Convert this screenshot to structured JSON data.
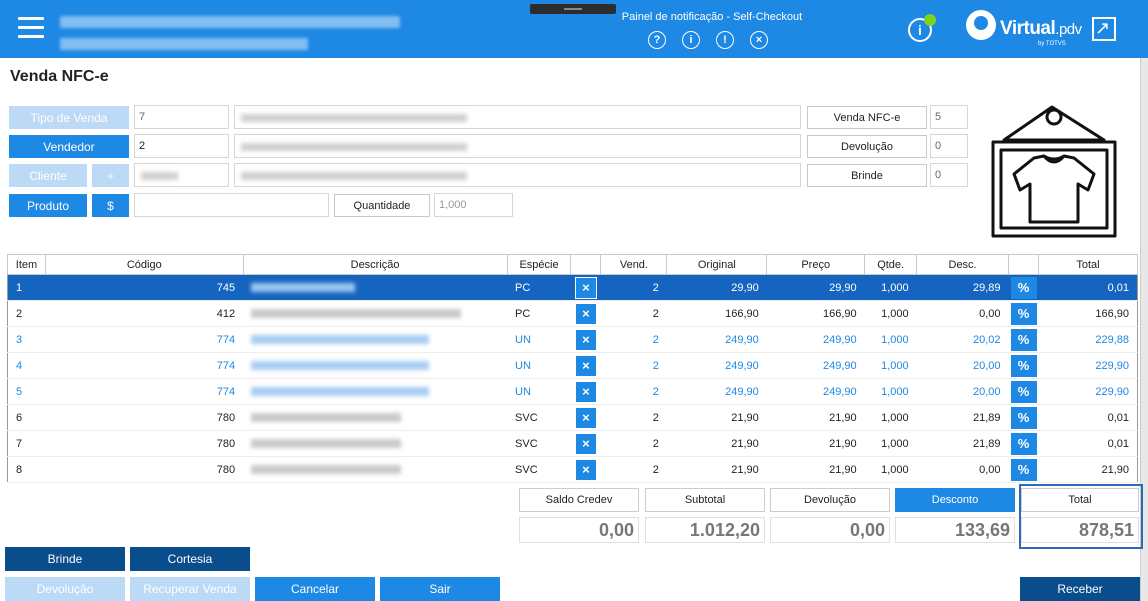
{
  "header": {
    "notification_title": "Painel de notificação - Self-Checkout",
    "notif_icons": [
      "?",
      "i",
      "!",
      "×"
    ],
    "info_icon": "i",
    "brand_name": "Virtual",
    "brand_suffix": ".pdv",
    "brand_byline": "by TOTVS",
    "accent_color": "#1e88e5"
  },
  "page_title": "Venda NFC-e",
  "form": {
    "tipo_venda_label": "Tipo de Venda",
    "tipo_venda_value": "7",
    "vendedor_label": "Vendedor",
    "vendedor_value": "2",
    "cliente_label": "Cliente",
    "cliente_add": "+",
    "produto_label": "Produto",
    "produto_dollar": "$",
    "quantidade_label": "Quantidade",
    "quantidade_placeholder": "1,000",
    "venda_nfce_label": "Venda NFC-e",
    "venda_nfce_value": "5",
    "devolucao_label": "Devolução",
    "devolucao_value": "0",
    "brinde_label": "Brinde",
    "brinde_value": "0"
  },
  "table": {
    "headers": [
      "Item",
      "Código",
      "Descrição",
      "Espécie",
      "",
      "Vend.",
      "Original",
      "Preço",
      "Qtde.",
      "Desc.",
      "",
      "Total"
    ],
    "rows": [
      {
        "item": "1",
        "codigo": "745",
        "especie": "PC",
        "vend": "2",
        "original": "29,90",
        "preco": "29,90",
        "qtde": "1,000",
        "desc": "29,89",
        "total": "0,01",
        "style": "sel"
      },
      {
        "item": "2",
        "codigo": "412",
        "especie": "PC",
        "vend": "2",
        "original": "166,90",
        "preco": "166,90",
        "qtde": "1,000",
        "desc": "0,00",
        "total": "166,90",
        "style": ""
      },
      {
        "item": "3",
        "codigo": "774",
        "especie": "UN",
        "vend": "2",
        "original": "249,90",
        "preco": "249,90",
        "qtde": "1,000",
        "desc": "20,02",
        "total": "229,88",
        "style": "blue"
      },
      {
        "item": "4",
        "codigo": "774",
        "especie": "UN",
        "vend": "2",
        "original": "249,90",
        "preco": "249,90",
        "qtde": "1,000",
        "desc": "20,00",
        "total": "229,90",
        "style": "blue"
      },
      {
        "item": "5",
        "codigo": "774",
        "especie": "UN",
        "vend": "2",
        "original": "249,90",
        "preco": "249,90",
        "qtde": "1,000",
        "desc": "20,00",
        "total": "229,90",
        "style": "blue"
      },
      {
        "item": "6",
        "codigo": "780",
        "especie": "SVC",
        "vend": "2",
        "original": "21,90",
        "preco": "21,90",
        "qtde": "1,000",
        "desc": "21,89",
        "total": "0,01",
        "style": ""
      },
      {
        "item": "7",
        "codigo": "780",
        "especie": "SVC",
        "vend": "2",
        "original": "21,90",
        "preco": "21,90",
        "qtde": "1,000",
        "desc": "21,89",
        "total": "0,01",
        "style": ""
      },
      {
        "item": "8",
        "codigo": "780",
        "especie": "SVC",
        "vend": "2",
        "original": "21,90",
        "preco": "21,90",
        "qtde": "1,000",
        "desc": "0,00",
        "total": "21,90",
        "style": ""
      }
    ],
    "remove_icon": "×",
    "discount_icon": "%"
  },
  "totals": {
    "saldo_credev_label": "Saldo Credev",
    "saldo_credev_value": "0,00",
    "subtotal_label": "Subtotal",
    "subtotal_value": "1.012,20",
    "devolucao_label": "Devolução",
    "devolucao_value": "0,00",
    "desconto_label": "Desconto",
    "desconto_value": "133,69",
    "total_label": "Total",
    "total_value": "878,51"
  },
  "actions": {
    "brinde": "Brinde",
    "cortesia": "Cortesia",
    "devolucao": "Devolução",
    "recuperar_venda": "Recuperar Venda",
    "cancelar": "Cancelar",
    "sair": "Sair",
    "receber": "Receber"
  }
}
